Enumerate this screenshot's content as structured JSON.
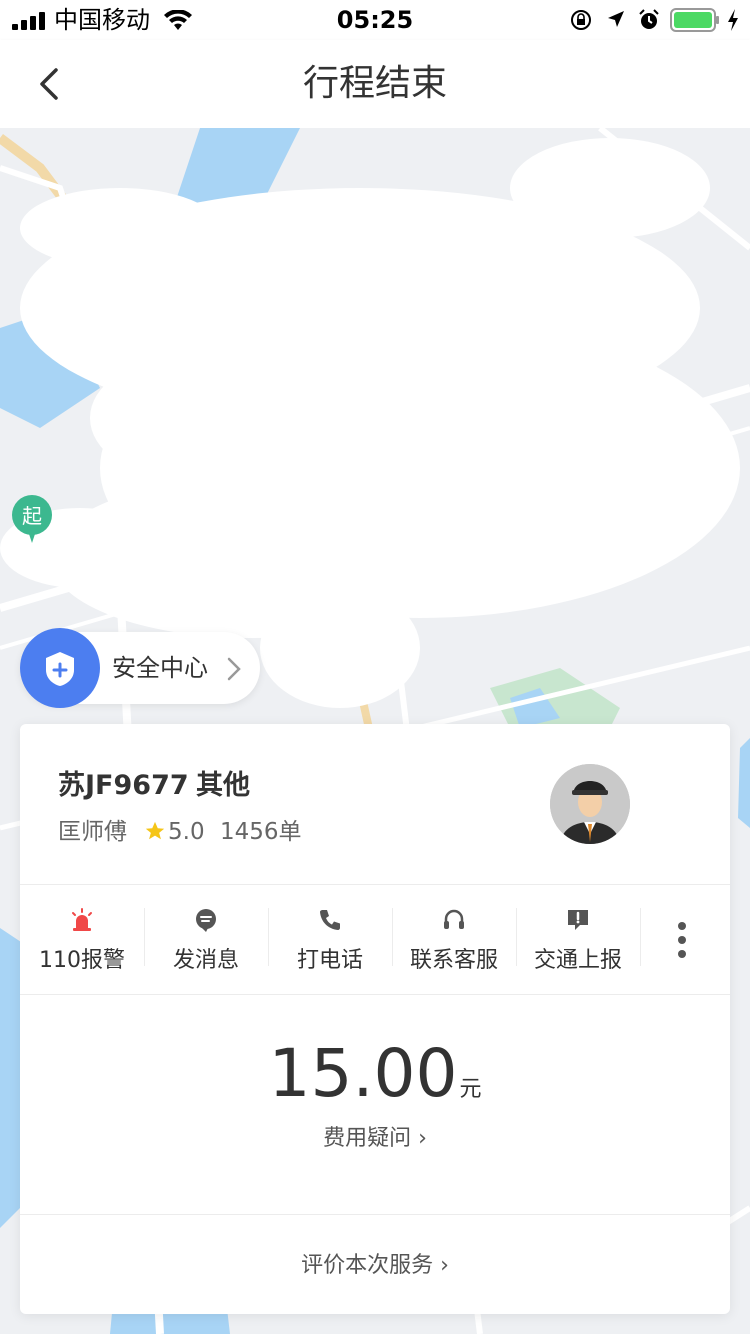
{
  "status_bar": {
    "carrier": "中国移动",
    "time": "05:25"
  },
  "nav": {
    "title": "行程结束"
  },
  "map": {
    "start_marker": "起"
  },
  "safety_center": {
    "label": "安全中心"
  },
  "driver": {
    "plate": "苏JF9677",
    "car_model": "其他",
    "name": "匡师傅",
    "rating": "5.0",
    "orders": "1456单"
  },
  "actions": [
    {
      "label": "110报警",
      "icon": "alarm-siren-icon",
      "color": "#f04848"
    },
    {
      "label": "发消息",
      "icon": "message-icon",
      "color": "#555555"
    },
    {
      "label": "打电话",
      "icon": "phone-icon",
      "color": "#555555"
    },
    {
      "label": "联系客服",
      "icon": "headset-icon",
      "color": "#555555"
    },
    {
      "label": "交通上报",
      "icon": "report-icon",
      "color": "#555555"
    }
  ],
  "fare": {
    "amount": "15.00",
    "unit": "元",
    "question": "费用疑问 ›"
  },
  "rate_service": {
    "label": "评价本次服务 ›"
  },
  "colors": {
    "accent_blue": "#4c7ef0",
    "start_green": "#3cb88f",
    "alarm_red": "#f04848",
    "star_gold": "#f5c518",
    "battery_green": "#4cd964"
  }
}
